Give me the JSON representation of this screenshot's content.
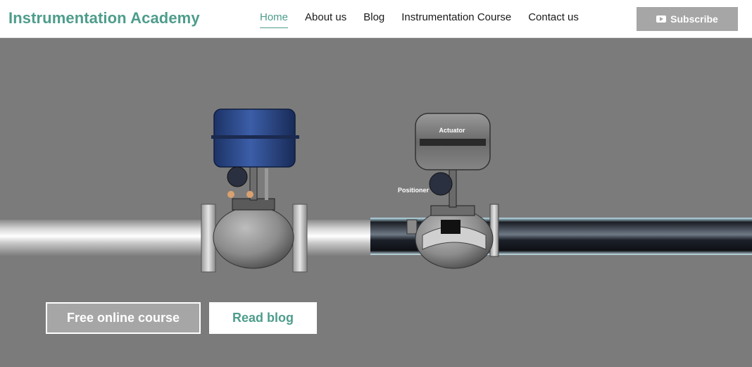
{
  "header": {
    "brand": "Instrumentation Academy",
    "nav": [
      {
        "label": "Home",
        "active": true
      },
      {
        "label": "About us",
        "active": false
      },
      {
        "label": "Blog",
        "active": false
      },
      {
        "label": "Instrumentation Course",
        "active": false
      },
      {
        "label": "Contact us",
        "active": false
      }
    ],
    "subscribe_label": "Subscribe",
    "subscribe_icon": "youtube-icon"
  },
  "hero": {
    "illustration_labels": {
      "actuator": "Actuator",
      "positioner": "Positioner"
    },
    "buttons": {
      "course": "Free online course",
      "blog": "Read blog"
    }
  },
  "colors": {
    "brand": "#4e9d8c",
    "hero_bg": "#7b7b7b",
    "button_gray": "#a6a6a6",
    "actuator_blue": "#2c4a8c"
  }
}
